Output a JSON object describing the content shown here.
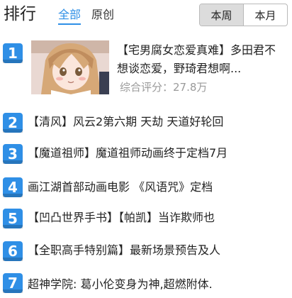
{
  "header": {
    "title": "排行",
    "tabs": [
      {
        "label": "全部",
        "active": true
      },
      {
        "label": "原创",
        "active": false
      }
    ],
    "period": {
      "options": [
        "本周",
        "本月"
      ],
      "selected": "本周"
    }
  },
  "featured": {
    "rank": "1",
    "title_line1": "【宅男腐女恋爱真难】多田君不",
    "title_line2": "想谈恋爱，野琦君想啊...",
    "score": "综合评分：27.8万",
    "thumb_icon": "anime-girl-thumbnail"
  },
  "items": [
    {
      "rank": "2",
      "title": "【清风】风云2第六期 天劫 天道好轮回"
    },
    {
      "rank": "3",
      "title": "【魔道祖师】魔道祖师动画终于定档7月"
    },
    {
      "rank": "4",
      "title": " 画江湖首部动画电影 《风语咒》定档"
    },
    {
      "rank": "5",
      "title": "【凹凸世界手书】【帕凯】当诈欺师也"
    },
    {
      "rank": "6",
      "title": "【全职高手特别篇】最新场景预告及人"
    },
    {
      "rank": "7",
      "title": " 超神学院: 葛小伦变身为神,超燃附体."
    }
  ],
  "colors": {
    "accent": "#2f8fe6",
    "badge": "#2f8fe6",
    "score_text": "#9a9a9a",
    "selected_segment": "#dcdcdc"
  }
}
